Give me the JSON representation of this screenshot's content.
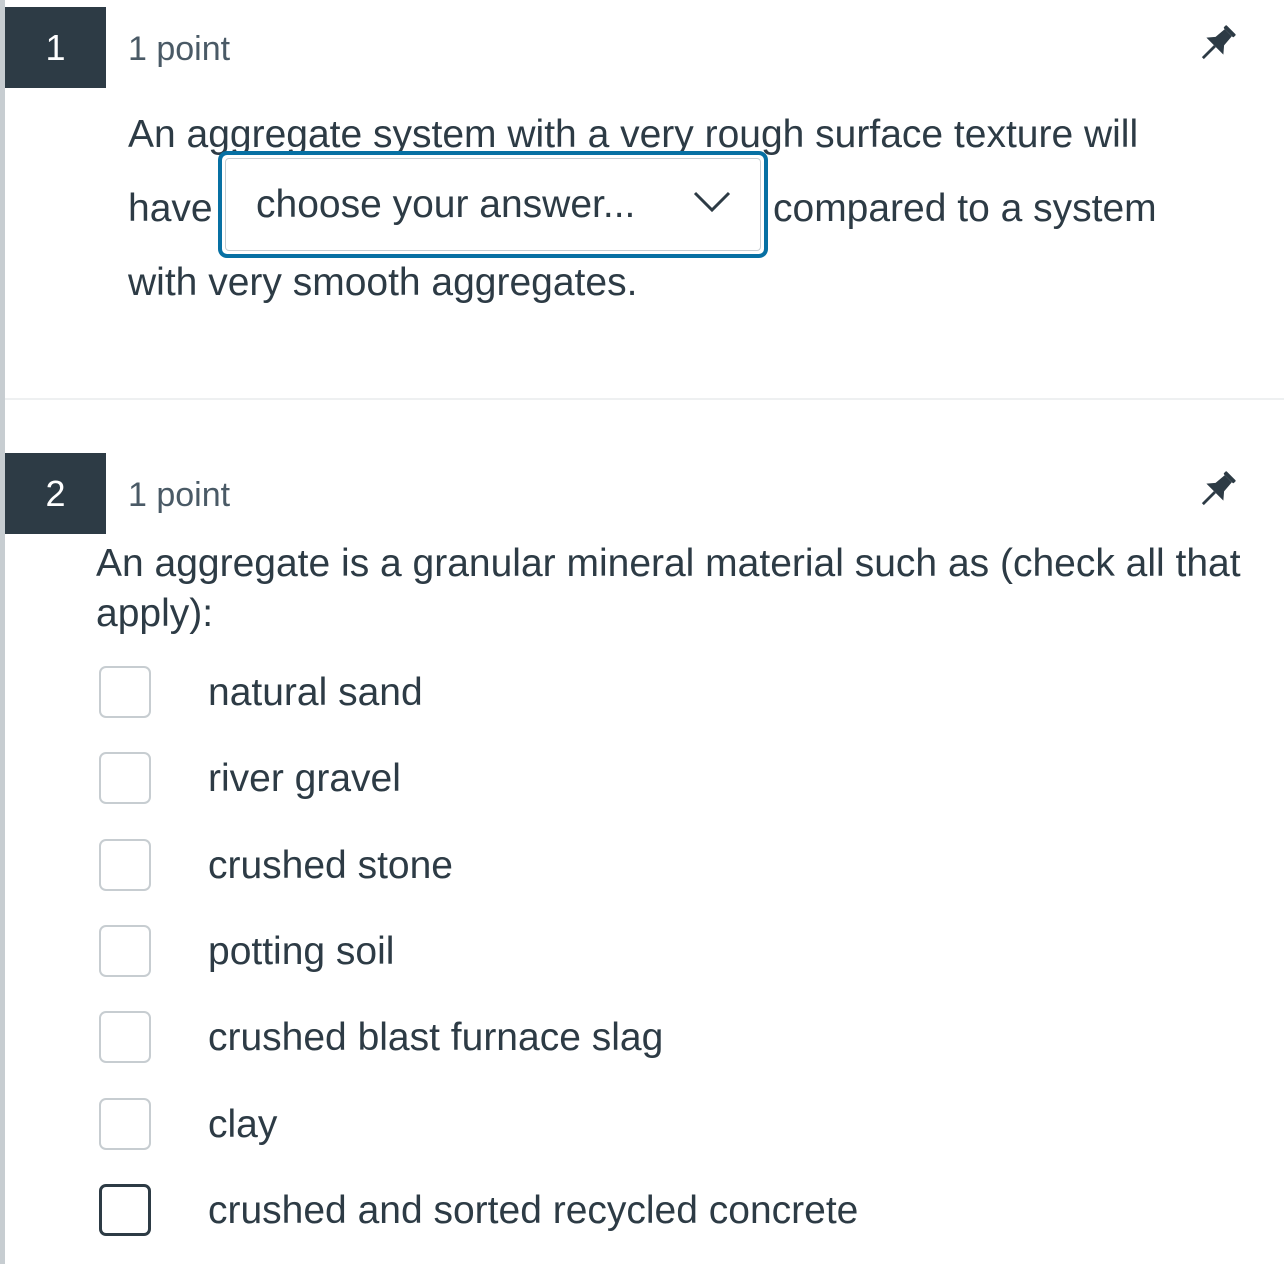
{
  "question1": {
    "number": "1",
    "points": "1 point",
    "text_before": "An aggregate system with a very rough surface texture will have",
    "select_value": "choose your answer...",
    "text_after": "compared to a system with very smooth aggregates.",
    "pin_icon": "pin-icon",
    "chevron_icon": "chevron-down-icon",
    "select_border_color": "#0770a3"
  },
  "question2": {
    "number": "2",
    "points": "1 point",
    "text": "An aggregate is a granular mineral material such as (check all that apply):",
    "pin_icon": "pin-icon",
    "options": [
      {
        "label": "natural sand",
        "checked": false
      },
      {
        "label": "river gravel",
        "checked": false
      },
      {
        "label": "crushed stone",
        "checked": false
      },
      {
        "label": "potting soil",
        "checked": false
      },
      {
        "label": "crushed blast furnace slag",
        "checked": false
      },
      {
        "label": "clay",
        "checked": false
      },
      {
        "label": "crushed and sorted recycled concrete",
        "checked": false
      }
    ]
  },
  "colors": {
    "number_badge_bg": "#2d3b45",
    "text": "#2d3b45",
    "checkbox_border": "#c7cdd1"
  }
}
